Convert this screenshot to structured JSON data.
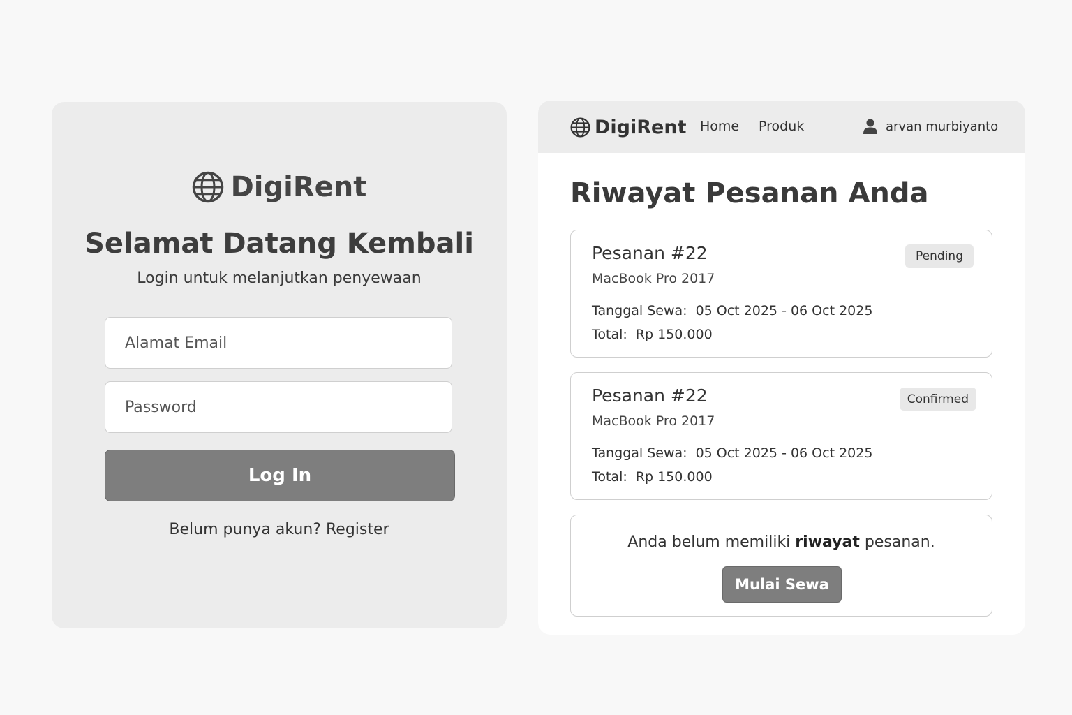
{
  "login": {
    "brand": "DigiRent",
    "title": "Selamat Datang Kembali",
    "subtitle": "Login untuk melanjutkan penyewaan",
    "email_placeholder": "Alamat Email",
    "password_placeholder": "Password",
    "login_button": "Log In",
    "register_prompt": "Belum punya akun?",
    "register_link": "Register"
  },
  "orders_page": {
    "nav": {
      "brand": "DigiRent",
      "links": [
        "Home",
        "Produk"
      ],
      "user_name": "arvan murbiyanto"
    },
    "heading": "Riwayat Pesanan Anda",
    "date_label": "Tanggal Sewa:",
    "total_label": "Total:",
    "orders": [
      {
        "title": "Pesanan #22",
        "product": "MacBook Pro 2017",
        "status": "Pending",
        "dates": "05 Oct 2025 - 06 Oct 2025",
        "total": "Rp 150.000"
      },
      {
        "title": "Pesanan #22",
        "product": "MacBook Pro 2017",
        "status": "Confirmed",
        "dates": "05 Oct 2025 - 06 Oct 2025",
        "total": "Rp 150.000"
      }
    ],
    "empty_state": {
      "text_before": "Anda belum memiliki",
      "text_bold": "riwayat",
      "text_after": "pesanan.",
      "button": "Mulai Sewa"
    }
  },
  "icons": {
    "brand_icon": "globe-icon",
    "user_icon": "user-icon"
  },
  "colors": {
    "page_background": "#f8f8f8",
    "card_background": "#ececec",
    "button_background": "#7e7e7e",
    "badge_background": "#e8e8e8"
  }
}
